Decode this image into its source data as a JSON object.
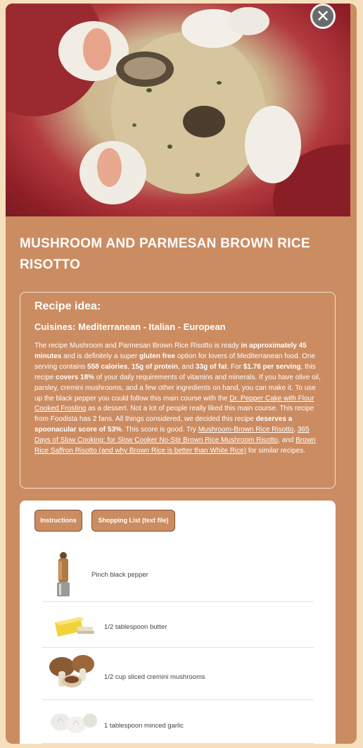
{
  "modal": {
    "close_glyph": "✕"
  },
  "recipe": {
    "title": "MUSHROOM AND PARMESAN BROWN RICE RISOTTO"
  },
  "idea": {
    "heading": "Recipe idea:",
    "cuisines": "Cuisines: Mediterranean - Italian - European",
    "segments": [
      {
        "text": "The recipe Mushroom and Parmesan Brown Rice Risotto is ready ",
        "style": "plain"
      },
      {
        "text": "in approximately 45 minutes",
        "style": "bold"
      },
      {
        "text": " and is definitely a super ",
        "style": "plain"
      },
      {
        "text": "gluten free",
        "style": "bold"
      },
      {
        "text": " option for lovers of Mediterranean food. One serving contains ",
        "style": "plain"
      },
      {
        "text": "558 calories",
        "style": "bold"
      },
      {
        "text": ", ",
        "style": "plain"
      },
      {
        "text": "15g of protein",
        "style": "bold"
      },
      {
        "text": ", and ",
        "style": "plain"
      },
      {
        "text": "33g of fat",
        "style": "bold"
      },
      {
        "text": ". For ",
        "style": "plain"
      },
      {
        "text": "$1.76 per serving",
        "style": "bold"
      },
      {
        "text": ", this recipe ",
        "style": "plain"
      },
      {
        "text": "covers 18%",
        "style": "bold"
      },
      {
        "text": " of your daily requirements of vitamins and minerals. If you have olive oil, parsley, cremini mushrooms, and a few other ingredients on hand, you can make it. To use up the black pepper you could follow this main course with the ",
        "style": "plain"
      },
      {
        "text": "Dr. Pepper Cake with Flour Cooked Frosting",
        "style": "link"
      },
      {
        "text": " as a dessert. Not a lot of people really liked this main course. This recipe from Foodista has 2 fans. All things considered, we decided this recipe ",
        "style": "plain"
      },
      {
        "text": "deserves a spoonacular score of 53%",
        "style": "bold"
      },
      {
        "text": ". This score is good. Try ",
        "style": "plain"
      },
      {
        "text": "Mushroom-Brown Rice Risotto",
        "style": "link"
      },
      {
        "text": ", ",
        "style": "plain"
      },
      {
        "text": "365 Days of Slow Cooking: for Slow Cooker No-Stir Brown Rice Mushroom Risotto",
        "style": "link"
      },
      {
        "text": ", and ",
        "style": "plain"
      },
      {
        "text": "Brown Rice Saffron Risotto (and why Brown Rice is better than White Rice)",
        "style": "link"
      },
      {
        "text": " for similar recipes.",
        "style": "plain"
      }
    ]
  },
  "tabs": {
    "instructions": "Instructions",
    "shopping_list": "Shopping List (text file)"
  },
  "ingredients": [
    {
      "label": "Pinch black pepper",
      "image": "pepper-grinder"
    },
    {
      "label": "1/2 tablespoon butter",
      "image": "butter"
    },
    {
      "label": "1/2 cup sliced cremini mushrooms",
      "image": "mushrooms"
    },
    {
      "label": "1 tablespoon minced garlic",
      "image": "garlic"
    }
  ],
  "colors": {
    "page_bg": "#f6dfbd",
    "card_bg": "#cc8c61",
    "button_border": "#7e4f30"
  }
}
